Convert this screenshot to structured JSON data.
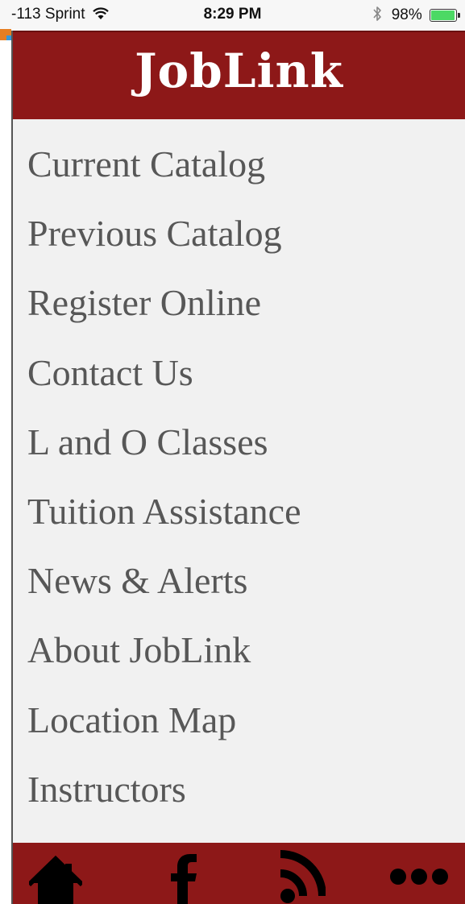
{
  "status_bar": {
    "carrier": "-113 Sprint",
    "time": "8:29 PM",
    "battery": "98%",
    "battery_level": 0.98,
    "icons": [
      "wifi-icon",
      "bluetooth-icon",
      "battery-icon"
    ]
  },
  "header": {
    "title": "JobLink"
  },
  "menu": {
    "items": [
      "Current Catalog",
      "Previous Catalog",
      "Register Online",
      "Contact Us",
      "L and O Classes",
      "Tuition Assistance",
      "News & Alerts",
      "About JobLink",
      "Location Map",
      "Instructors"
    ]
  },
  "tab_bar": {
    "icons": [
      "home-icon",
      "facebook-icon",
      "rss-icon",
      "more-icon"
    ]
  },
  "colors": {
    "brand": "#8d1818",
    "menu_background": "#f1f1f1",
    "menu_text": "#575757",
    "battery": "#4cd964"
  }
}
